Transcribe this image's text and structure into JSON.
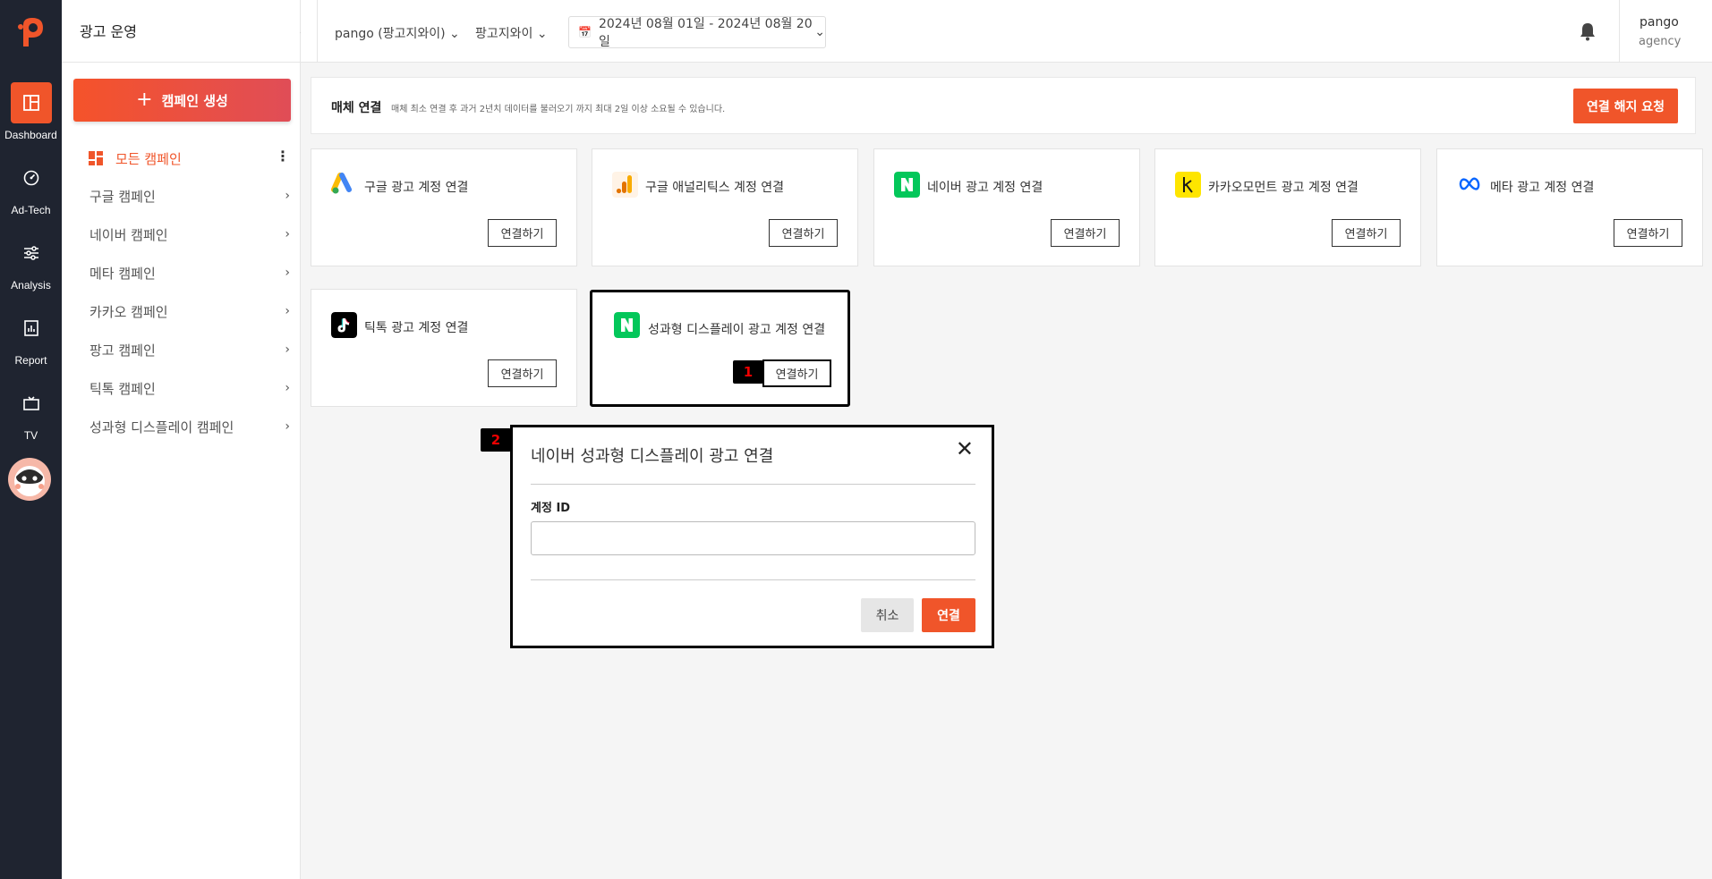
{
  "rail": {
    "items": [
      {
        "label": "Dashboard",
        "icon": "dashboard-icon",
        "active": true
      },
      {
        "label": "Ad-Tech",
        "icon": "gauge-icon"
      },
      {
        "label": "Analysis",
        "icon": "sliders-icon"
      },
      {
        "label": "Report",
        "icon": "report-icon"
      },
      {
        "label": "TV",
        "icon": "tv-icon"
      }
    ]
  },
  "sidebar": {
    "title": "광고 운영",
    "create_label": "캠페인 생성",
    "all_label": "모든 캠페인",
    "items": [
      {
        "label": "구글 캠페인"
      },
      {
        "label": "네이버 캠페인"
      },
      {
        "label": "메타 캠페인"
      },
      {
        "label": "카카오 캠페인"
      },
      {
        "label": "팡고 캠페인"
      },
      {
        "label": "틱톡 캠페인"
      },
      {
        "label": "성과형 디스플레이 캠페인"
      }
    ]
  },
  "header": {
    "account_select": "pango (팡고지와이)",
    "advertiser_select": "팡고지와이",
    "date_range": "2024년 08월 01일 - 2024년 08월 20일",
    "user_name": "pango",
    "user_org": "agency"
  },
  "notice": {
    "title": "매체 연결",
    "description": "매체 최소 연결 후 과거 2년치 데이터를 불러오기 까지 최대 2일 이상 소요될 수 있습니다.",
    "disconnect_label": "연결 해지 요청"
  },
  "cards": [
    {
      "label": "구글 광고 계정 연결",
      "button": "연결하기",
      "icon": "google-ads-icon"
    },
    {
      "label": "구글 애널리틱스 계정 연결",
      "button": "연결하기",
      "icon": "google-analytics-icon"
    },
    {
      "label": "네이버 광고 계정 연결",
      "button": "연결하기",
      "icon": "naver-icon"
    },
    {
      "label": "카카오모먼트 광고 계정 연결",
      "button": "연결하기",
      "icon": "kakao-icon"
    },
    {
      "label": "메타 광고 계정 연결",
      "button": "연결하기",
      "icon": "meta-icon"
    },
    {
      "label": "틱톡 광고 계정 연결",
      "button": "연결하기",
      "icon": "tiktok-icon"
    },
    {
      "label": "성과형 디스플레이 광고 계정 연결",
      "button": "연결하기",
      "icon": "naver-icon"
    }
  ],
  "annotations": {
    "step1": "1",
    "step2": "2"
  },
  "modal": {
    "title": "네이버 성과형 디스플레이 광고 연결",
    "field_label": "계정 ID",
    "field_value": "",
    "cancel_label": "취소",
    "connect_label": "연결"
  },
  "colors": {
    "accent": "#f0552a",
    "rail_bg": "#1f2430",
    "naver_green": "#03c75a",
    "kakao_yellow": "#fee500"
  }
}
